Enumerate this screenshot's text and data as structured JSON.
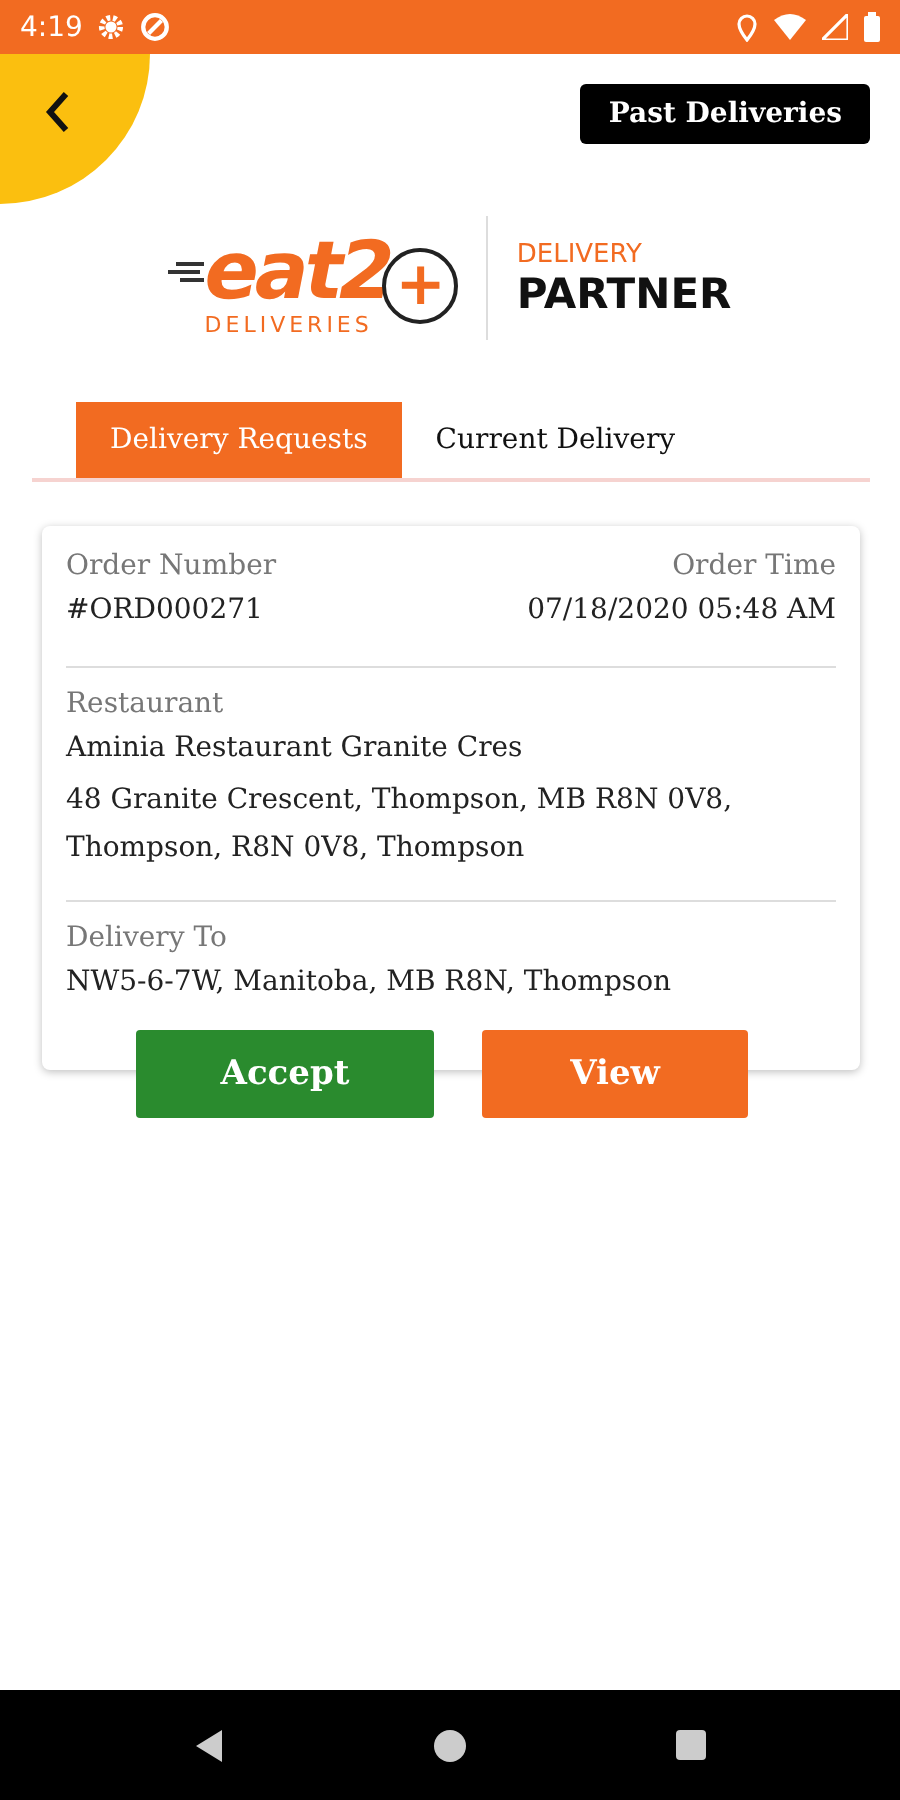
{
  "status_bar": {
    "time": "4:19"
  },
  "header": {
    "past_deliveries_button": "Past Deliveries"
  },
  "logo": {
    "brand": "eat2",
    "plus": "+",
    "tagline": "DELIVERIES",
    "subtitle": "DELIVERY",
    "title": "PARTNER"
  },
  "tabs": [
    {
      "label": "Delivery Requests",
      "selected": true
    },
    {
      "label": "Current Delivery",
      "selected": false
    }
  ],
  "order_card": {
    "order_number_label": "Order Number",
    "order_number": "#ORD000271",
    "order_time_label": "Order Time",
    "order_time": "07/18/2020 05:48 AM",
    "restaurant_label": "Restaurant",
    "restaurant_name": "Aminia Restaurant Granite Cres",
    "restaurant_address": "48 Granite Crescent, Thompson, MB R8N 0V8, Thompson, R8N 0V8, Thompson",
    "delivery_label": "Delivery To",
    "delivery_address": "NW5-6-7W, Manitoba, MB R8N, Thompson"
  },
  "actions": [
    {
      "label": "Accept",
      "kind": "accept"
    },
    {
      "label": "View",
      "kind": "view"
    }
  ]
}
